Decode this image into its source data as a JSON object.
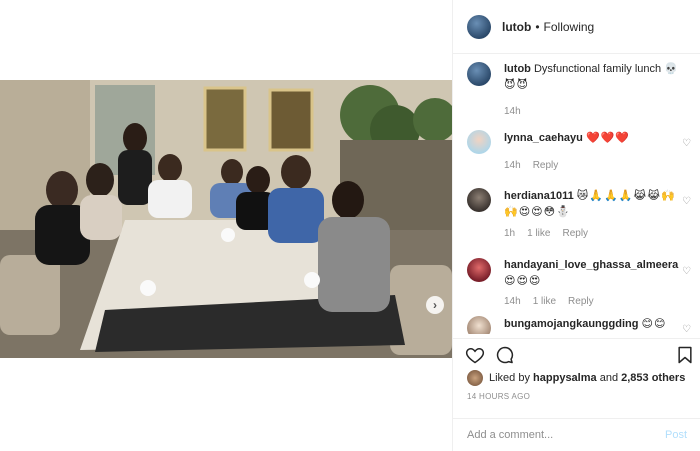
{
  "post": {
    "username": "lutob",
    "separator": "•",
    "follow_status": "Following"
  },
  "caption": {
    "username": "lutob",
    "text": "Dysfunctional family lunch 💀",
    "emojis": "😈😈",
    "time": "14h"
  },
  "comments": [
    {
      "username": "lynna_caehayu",
      "text": "",
      "emojis": "❤️❤️❤️",
      "time": "14h",
      "likes": "",
      "reply": "Reply"
    },
    {
      "username": "herdiana1011",
      "text": "",
      "emojis": "😿🙏🙏🙏😹😹🙌🙌😍😍😳⛄",
      "time": "1h",
      "likes": "1 like",
      "reply": "Reply"
    },
    {
      "username": "handayani_love_ghassa_almeera",
      "text": "",
      "emojis": "😍😍😍",
      "time": "14h",
      "likes": "1 like",
      "reply": "Reply"
    },
    {
      "username": "bungamojangkaunggding",
      "text": "",
      "emojis": "😊😊",
      "time": "",
      "likes": "",
      "reply": ""
    }
  ],
  "likes": {
    "prefix": "Liked by",
    "user": "happysalma",
    "connector": "and",
    "others": "2,853 others"
  },
  "timestamp": "14 HOURS AGO",
  "add_comment": {
    "placeholder": "Add a comment...",
    "post_label": "Post"
  },
  "icons": {
    "like": "heart-outline-icon",
    "comment": "comment-bubble-icon",
    "save": "bookmark-icon",
    "next": "chevron-right-icon"
  },
  "colors": {
    "text": "#262626",
    "muted": "#8e8e8e",
    "border": "#efefef",
    "post_disabled": "#b2dffc"
  }
}
